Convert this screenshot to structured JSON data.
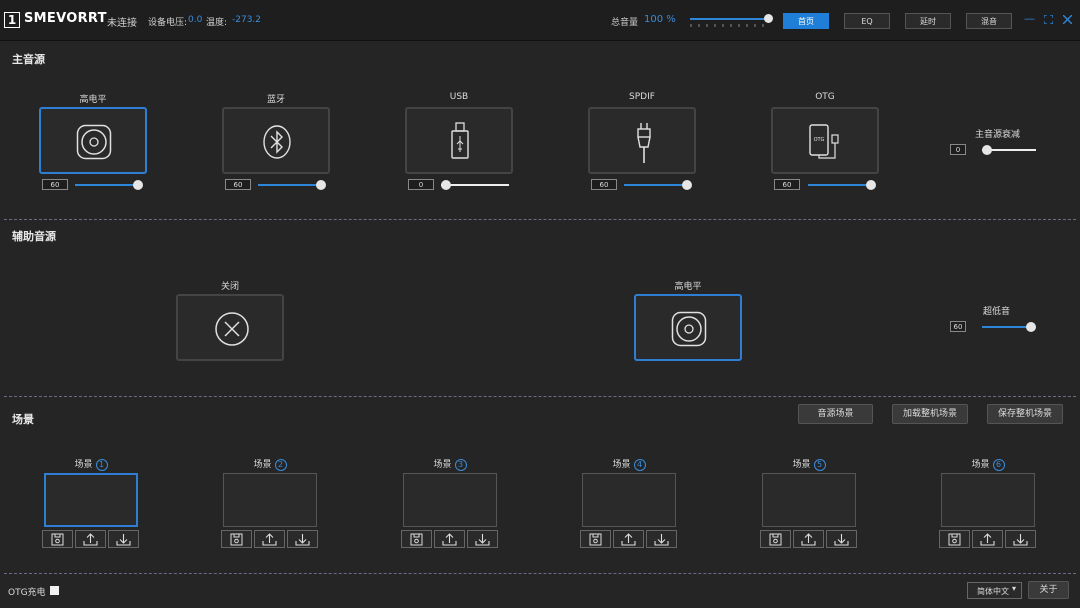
{
  "header": {
    "logo_mark": "1",
    "brand": "SMEVORRT",
    "status": "未连接",
    "voltage_label": "设备电压:",
    "voltage_value": "0.0",
    "temp_label": "温度:",
    "temp_value": "-273.2",
    "volume_label": "总音量",
    "volume_value": "100 %",
    "volume_level": 1.0,
    "nav": [
      "首页",
      "EQ",
      "延时",
      "混音"
    ],
    "active_nav": 0,
    "accent": "#2e86d8"
  },
  "main_source": {
    "title": "主音源",
    "sources": [
      {
        "label": "高电平",
        "value": "60",
        "level": 1.0,
        "selected": true,
        "icon": "speaker-icon"
      },
      {
        "label": "蓝牙",
        "value": "60",
        "level": 1.0,
        "selected": false,
        "icon": "bluetooth-icon"
      },
      {
        "label": "USB",
        "value": "0",
        "level": 0.0,
        "selected": false,
        "icon": "usb-icon"
      },
      {
        "label": "SPDIF",
        "value": "60",
        "level": 1.0,
        "selected": false,
        "icon": "spdif-cable-icon"
      },
      {
        "label": "OTG",
        "value": "60",
        "level": 1.0,
        "selected": false,
        "icon": "otg-phone-icon",
        "icon_text": "OTG"
      }
    ],
    "attenuation_label": "主音源衰减",
    "attenuation_value": "0",
    "attenuation_level": 0.0
  },
  "aux_source": {
    "title": "辅助音源",
    "options": [
      {
        "label": "关闭",
        "selected": false,
        "icon": "close-circle-icon"
      },
      {
        "label": "高电平",
        "selected": true,
        "icon": "speaker-icon"
      }
    ],
    "subwoofer_label": "超低音",
    "subwoofer_value": "60",
    "subwoofer_level": 1.0
  },
  "scenes": {
    "title": "场景",
    "buttons": [
      "音源场景",
      "加载整机场景",
      "保存整机场景"
    ],
    "label": "场景",
    "items": [
      "1",
      "2",
      "3",
      "4",
      "5",
      "6"
    ],
    "selected": 0,
    "actions": [
      "save-icon",
      "upload-icon",
      "download-icon"
    ]
  },
  "footer": {
    "otg_charge_label": "OTG充电",
    "otg_charge_checked": true,
    "language": "简体中文",
    "about": "关于"
  }
}
